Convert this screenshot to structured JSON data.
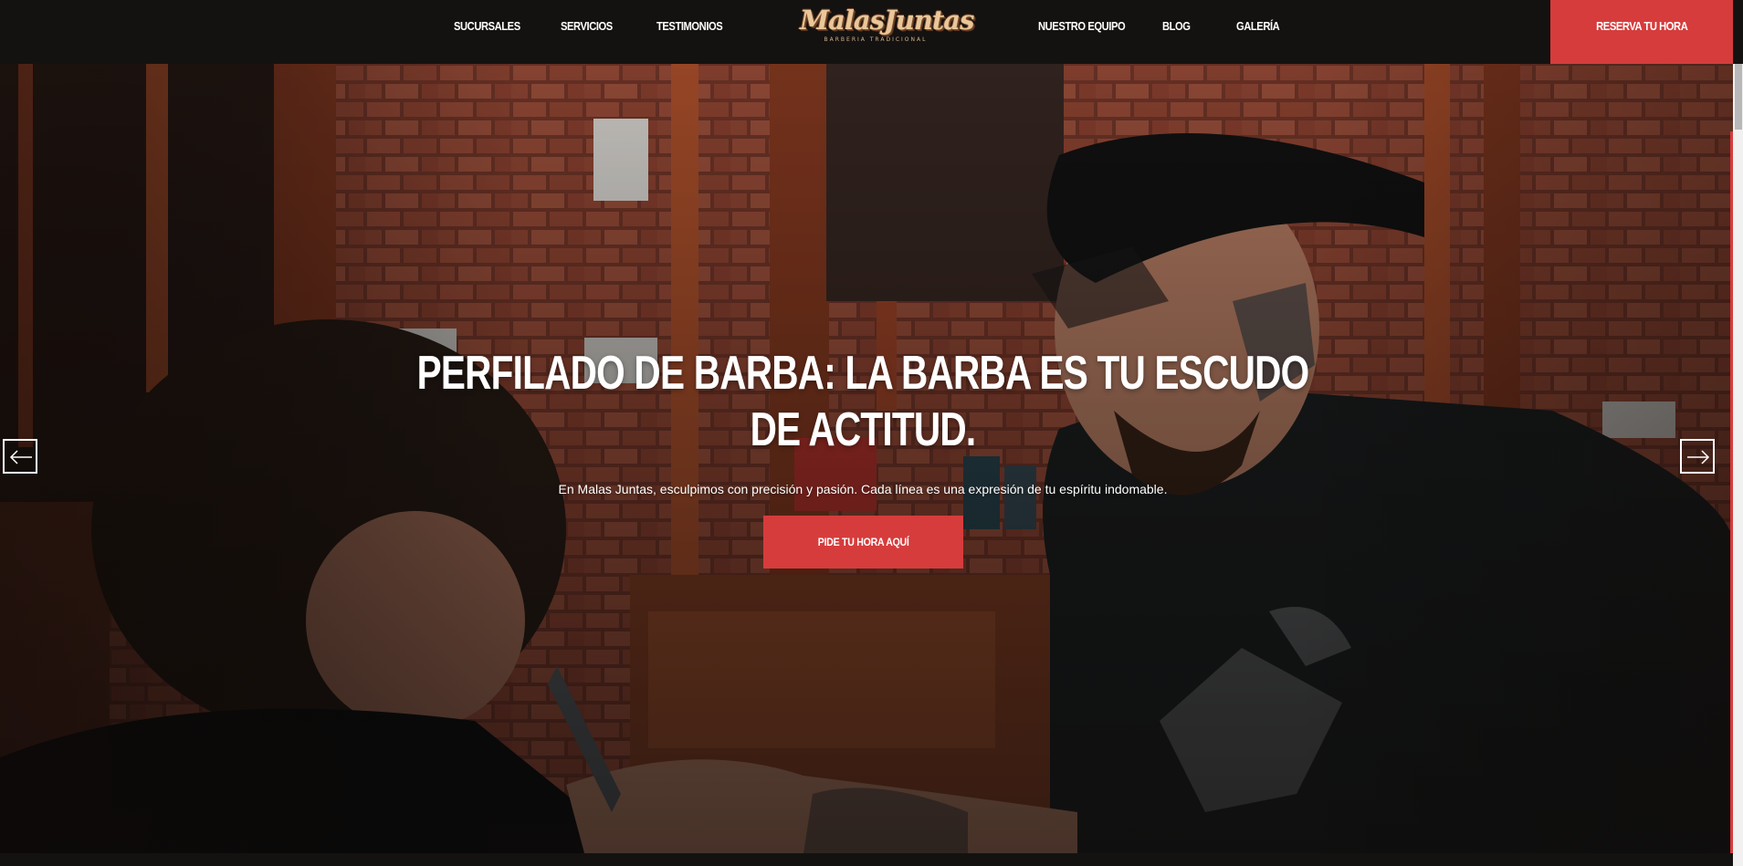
{
  "nav": {
    "left_links": [
      "SUCURSALES",
      "SERVICIOS",
      "TESTIMONIOS"
    ],
    "right_links": [
      "NUESTRO EQUIPO",
      "BLOG",
      "GALERÍA"
    ],
    "reserve_label": "RESERVA TU HORA"
  },
  "logo": {
    "name": "MalasJuntas",
    "tagline": "BARBERIA TRADICIONAL"
  },
  "hero": {
    "title": "PERFILADO DE BARBA: LA BARBA ES TU ESCUDO DE ACTITUD.",
    "subtitle": "En Malas Juntas, esculpimos con precisión y pasión. Cada línea es una expresión de tu espíritu indomable.",
    "cta_label": "PIDE TU HORA AQUÍ",
    "prev_icon": "arrow-left-icon",
    "next_icon": "arrow-right-icon"
  },
  "colors": {
    "accent": "#d63c3c",
    "nav_bg": "#141211",
    "logo_gold": "#e9c79a"
  }
}
